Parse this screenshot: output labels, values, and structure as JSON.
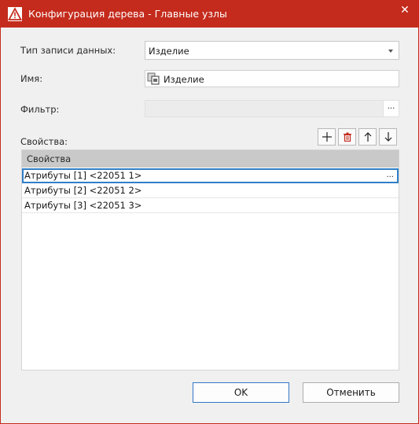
{
  "window": {
    "title": "Конфигурация дерева - Главные узлы",
    "close_glyph": "✕"
  },
  "form": {
    "record_type_label": "Тип записи данных:",
    "record_type_value": "Изделие",
    "name_label": "Имя:",
    "name_value": "Изделие",
    "filter_label": "Фильтр:",
    "filter_button": "...",
    "properties_label": "Свойства:"
  },
  "toolbar": {
    "add_icon": "plus-icon",
    "delete_icon": "trash-icon",
    "up_icon": "arrow-up-icon",
    "down_icon": "arrow-down-icon"
  },
  "grid": {
    "header": "Свойства",
    "rows": [
      "Атрибуты [1] <22051 1>",
      "Атрибуты [2] <22051 2>",
      "Атрибуты [3] <22051 3>"
    ],
    "row_ellipsis": "..."
  },
  "buttons": {
    "ok": "OK",
    "cancel": "Отменить"
  },
  "colors": {
    "titlebar": "#c42b1c",
    "selection_border": "#2f7fc8",
    "header_bg": "#c9c9c9"
  }
}
